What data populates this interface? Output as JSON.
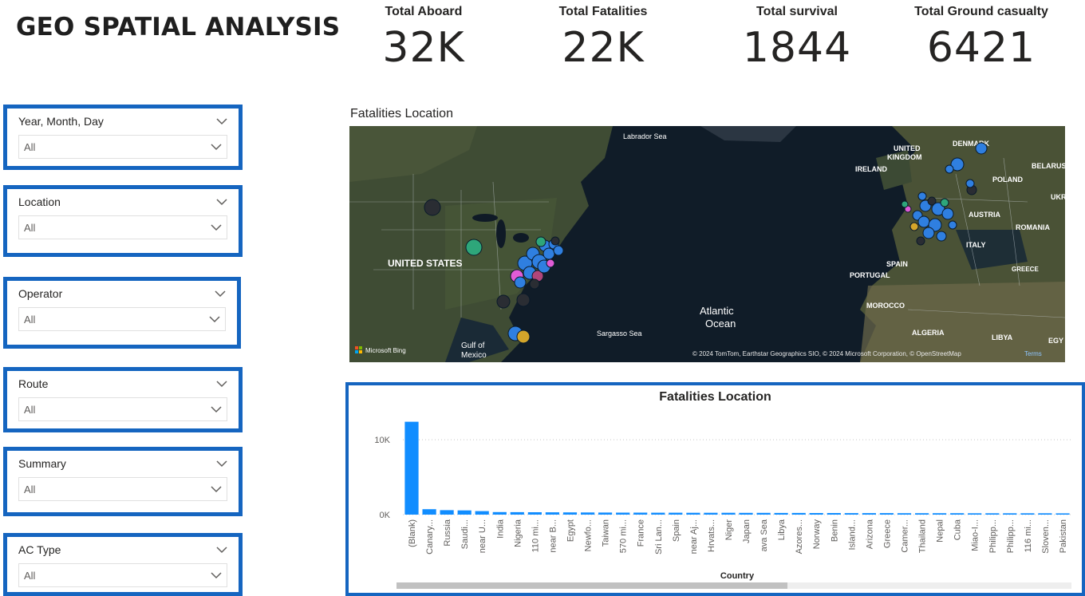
{
  "header": {
    "title": "GEO SPATIAL ANALYSIS"
  },
  "kpis": [
    {
      "label": "Total Aboard",
      "value": "32K"
    },
    {
      "label": "Total Fatalities",
      "value": "22K"
    },
    {
      "label": "Total survival",
      "value": "1844"
    },
    {
      "label": "Total Ground casualty",
      "value": "6421"
    }
  ],
  "slicers": [
    {
      "label": "Year, Month, Day",
      "value": "All"
    },
    {
      "label": "Location",
      "value": "All"
    },
    {
      "label": "Operator",
      "value": "All"
    },
    {
      "label": "Route",
      "value": "All"
    },
    {
      "label": "Summary",
      "value": "All"
    },
    {
      "label": "AC Type",
      "value": "All"
    }
  ],
  "map": {
    "title": "Fatalities Location",
    "labels": [
      "Labrador Sea",
      "UNITED STATES",
      "Atlantic",
      "Ocean",
      "Sargasso Sea",
      "Gulf of",
      "Mexico",
      "UNITED",
      "KINGDOM",
      "IRELAND",
      "DENMARK",
      "BELARUS",
      "POLAND",
      "UKR",
      "AUSTRIA",
      "ROMANIA",
      "ITALY",
      "SPAIN",
      "PORTUGAL",
      "GREECE",
      "MOROCCO",
      "ALGERIA",
      "LIBYA",
      "EGY"
    ],
    "logo": "Microsoft Bing",
    "attribution": "© 2024 TomTom, Earthstar Geographics SIO, © 2024 Microsoft Corporation, © OpenStreetMap",
    "terms": "Terms",
    "colors": {
      "ocean": "#0f1a26",
      "land": "#3d4a33",
      "bubble": "#2f7fe0"
    }
  },
  "chart_data": {
    "type": "bar",
    "title": "Fatalities Location",
    "xlabel": "Country",
    "ylabel": "",
    "ylim": [
      0,
      13000
    ],
    "ytick_labels": [
      "0K",
      "10K"
    ],
    "yticks": [
      0,
      10000
    ],
    "categories": [
      "(Blank)",
      "Canary...",
      "Russia",
      "Saudi...",
      "near U...",
      "India",
      "Nigeria",
      "110 mi...",
      "near B...",
      "Egypt",
      "Newfo...",
      "Taiwan",
      "570 mi...",
      "France",
      "Sri Lan...",
      "Spain",
      "near Aj...",
      "Hrvats...",
      "Niger",
      "Japan",
      "ava Sea",
      "Libya",
      "Azores...",
      "Norway",
      "Benin",
      "Island...",
      "Arizona",
      "Greece",
      "Camer...",
      "Thailand",
      "Nepal",
      "Cuba",
      "Miao-I...",
      "Philipp...",
      "Philipp...",
      "116 mi...",
      "Sloven...",
      "Pakistan"
    ],
    "values": [
      12400,
      720,
      600,
      560,
      470,
      340,
      330,
      320,
      310,
      300,
      290,
      280,
      270,
      265,
      260,
      255,
      250,
      245,
      240,
      235,
      230,
      225,
      220,
      215,
      210,
      205,
      200,
      198,
      195,
      192,
      190,
      188,
      185,
      182,
      180,
      178,
      176,
      174
    ],
    "bar_color": "#118dff"
  }
}
